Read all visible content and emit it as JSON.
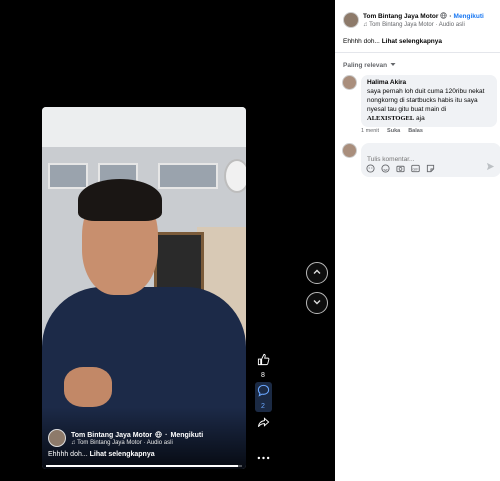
{
  "post": {
    "author": "Tom Bintang Jaya Motor",
    "follow_label": "Mengikuti",
    "audio": "Tom Bintang Jaya Motor · Audio asli",
    "caption": "Ehhhh doh...",
    "see_more": "Lihat selengkapnya"
  },
  "video": {
    "author": "Tom Bintang Jaya Motor",
    "follow_label": "Mengikuti",
    "audio": "Tom Bintang Jaya Motor · Audio asli",
    "caption": "Ehhhh doh...",
    "see_more": "Lihat selengkapnya",
    "progress": 0.98
  },
  "rail": {
    "like_count": "8",
    "comment_count": "2"
  },
  "comments": {
    "sort_label": "Paling relevan",
    "items": [
      {
        "author": "Halima Akira",
        "text": "saya pernah loh duit cuma 120ribu nekat nongkorng di startbucks habis itu saya nyesal tau gitu buat main di",
        "highlight": "ALEXISTOGEL",
        "suffix": "aja",
        "time": "1 menit",
        "like_label": "Suka",
        "reply_label": "Balas"
      }
    ],
    "compose_placeholder": "Tulis komentar..."
  },
  "icons": {
    "globe": "globe-icon",
    "music": "music-note-icon",
    "like": "thumbs-up-icon",
    "comment": "comment-icon",
    "share": "share-icon",
    "more": "more-icon",
    "up": "chevron-up-icon",
    "down": "chevron-down-icon"
  },
  "colors": {
    "accent": "#1877f2",
    "panel_bg": "#ffffff",
    "viewer_bg": "#000000",
    "bubble_bg": "#f0f2f5"
  }
}
